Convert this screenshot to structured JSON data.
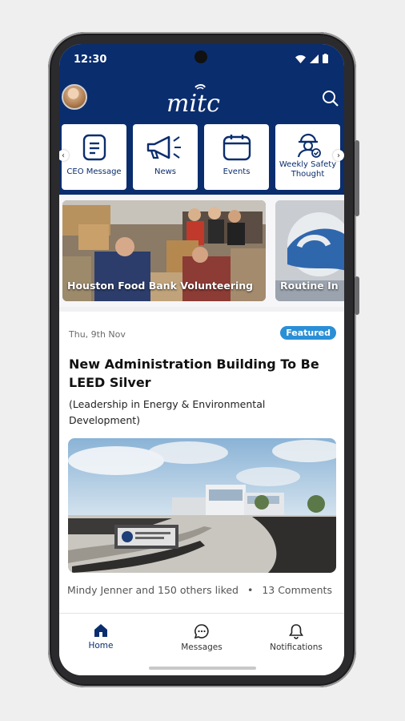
{
  "status": {
    "time": "12:30"
  },
  "header": {
    "logo_text": "mitc"
  },
  "quick_links": [
    {
      "label": "CEO Message",
      "icon": "document-icon"
    },
    {
      "label": "News",
      "icon": "megaphone-icon"
    },
    {
      "label": "Events",
      "icon": "calendar-icon"
    },
    {
      "label": "Weekly Safety Thought",
      "icon": "safety-worker-icon"
    }
  ],
  "carousel": [
    {
      "title": "Houston Food Bank Volunteering"
    },
    {
      "title": "Routine In"
    }
  ],
  "post": {
    "date": "Thu, 9th Nov",
    "badge": "Featured",
    "title": "New Administration Building To Be LEED Silver",
    "subtitle": "(Leadership in Energy & Environmental Development)",
    "likes": "Mindy Jenner and 150 others liked",
    "separator": "•",
    "comments": "13 Comments"
  },
  "nav": [
    {
      "label": "Home",
      "active": true
    },
    {
      "label": "Messages"
    },
    {
      "label": "Notifications"
    }
  ],
  "colors": {
    "brand_navy": "#0a2d6e",
    "badge_blue": "#2a8fd6"
  }
}
